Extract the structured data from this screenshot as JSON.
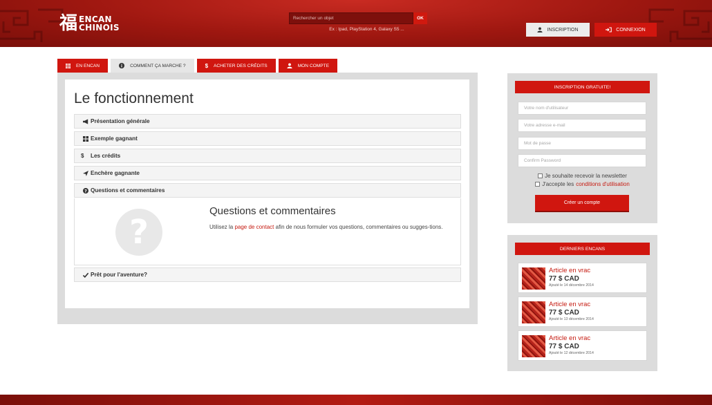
{
  "header": {
    "logo": {
      "char": "福",
      "line1": "ENCAN",
      "line2": "CHINOIS"
    },
    "search": {
      "placeholder": "Rechercher un objet",
      "button": "OK",
      "hint": "Ex : Ipad, PlayStation 4, Galaxy S5 ..."
    },
    "buttons": {
      "inscription": "INSCRIPTION",
      "connexion": "CONNEXION"
    }
  },
  "tabs": [
    {
      "label": "EN ENCAN",
      "icon": "grid-icon",
      "active": false
    },
    {
      "label": "COMMENT ÇA MARCHE ?",
      "icon": "info-icon",
      "active": true
    },
    {
      "label": "ACHETER DES CRÉDITS",
      "icon": "dollar-icon",
      "active": false
    },
    {
      "label": "MON COMPTE",
      "icon": "user-icon",
      "active": false
    }
  ],
  "main": {
    "title": "Le fonctionnement",
    "accordion": [
      {
        "label": "Présentation générale",
        "icon": "megaphone-icon"
      },
      {
        "label": "Exemple gagnant",
        "icon": "grid-icon"
      },
      {
        "label": "Les crédits",
        "icon": "dollar-icon"
      },
      {
        "label": "Enchère gagnante",
        "icon": "send-icon"
      },
      {
        "label": "Questions et commentaires",
        "icon": "question-icon",
        "expanded": true
      },
      {
        "label": "Prêt pour l'aventure?",
        "icon": "check-icon"
      }
    ],
    "questions": {
      "title": "Questions et commentaires",
      "text_before": "Utilisez la ",
      "link": "page de contact",
      "text_after": " afin de nous formuler vos questions, commentaires ou sugges-tions."
    }
  },
  "sidebar": {
    "signup": {
      "header": "INSCRIPTION GRATUITE!",
      "username_placeholder": "Votre nom d'utilisateur",
      "email_placeholder": "Votre adresse e-mail",
      "password_placeholder": "Mot de passe",
      "confirm_placeholder": "Confirm Password",
      "newsletter": "Je souhaite recevoir la newsletter",
      "terms_prefix": "J'accepte les ",
      "terms_link": "conditions d'utilisation",
      "create_button": "Créer un compte"
    },
    "auctions": {
      "header": "DERNIERS ENCANS",
      "items": [
        {
          "title": "Article en vrac",
          "price": "77 $ CAD",
          "date": "Ajouté le 14 décembre 2014"
        },
        {
          "title": "Article en vrac",
          "price": "77 $ CAD",
          "date": "Ajouté le 13 décembre 2014"
        },
        {
          "title": "Article en vrac",
          "price": "77 $ CAD",
          "date": "Ajouté le 12 décembre 2014"
        }
      ]
    }
  },
  "colors": {
    "brand_red": "#d0160f",
    "header_red": "#9e1710",
    "panel_gray": "#dcdcdc"
  }
}
